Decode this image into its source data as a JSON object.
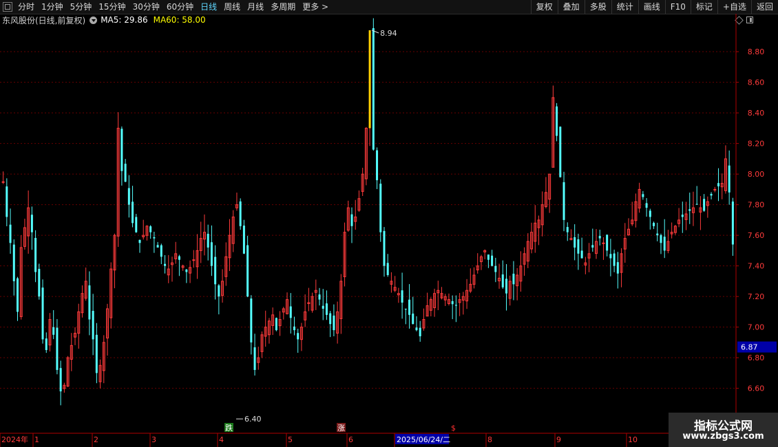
{
  "toolbar": {
    "left_items": [
      "分时",
      "1分钟",
      "5分钟",
      "15分钟",
      "30分钟",
      "60分钟",
      "日线",
      "周线",
      "月线",
      "多周期",
      "更多 >"
    ],
    "active_item": "日线",
    "right_items": [
      "复权",
      "叠加",
      "多股",
      "统计",
      "画线",
      "F10",
      "标记",
      "+自选",
      "返回"
    ]
  },
  "info": {
    "stock_name": "东风股份(日线,前复权)",
    "ma5": "MA5: 29.86",
    "ma60": "MA60: 58.00"
  },
  "chart_data": {
    "type": "candlestick",
    "ylim": [
      6.4,
      8.94
    ],
    "yticks": [
      "8.80",
      "8.60",
      "8.40",
      "8.20",
      "8.00",
      "7.80",
      "7.60",
      "7.40",
      "7.20",
      "7.00",
      "6.80",
      "6.60"
    ],
    "current_price": "6.87",
    "high_label": "8.94",
    "low_label": "6.40",
    "xlabels": [
      "2024年",
      "1",
      "2",
      "3",
      "4",
      "5",
      "6",
      "2025/06/24/二",
      "8",
      "9",
      "10"
    ],
    "markers": [
      "跌",
      "涨",
      "$"
    ],
    "colors": {
      "up": "#ff3b3b",
      "down": "#54ffff",
      "grid": "#6a0000",
      "axis": "#b00000",
      "highlight": "#ffd000"
    },
    "closes": [
      7.95,
      7.72,
      7.55,
      7.3,
      7.1,
      7.52,
      7.65,
      7.78,
      7.62,
      7.36,
      7.2,
      6.92,
      6.85,
      7.05,
      6.95,
      6.72,
      6.58,
      6.62,
      6.8,
      6.88,
      6.96,
      7.1,
      7.22,
      7.3,
      7.05,
      6.92,
      6.7,
      6.75,
      6.9,
      7.12,
      7.38,
      7.6,
      8.3,
      8.02,
      7.95,
      7.8,
      7.68,
      7.62,
      7.55,
      7.6,
      7.66,
      7.62,
      7.58,
      7.52,
      7.46,
      7.4,
      7.38,
      7.42,
      7.48,
      7.44,
      7.4,
      7.36,
      7.39,
      7.44,
      7.5,
      7.58,
      7.62,
      7.52,
      7.4,
      7.28,
      7.2,
      7.3,
      7.46,
      7.6,
      7.72,
      7.8,
      7.66,
      7.48,
      7.2,
      6.9,
      6.72,
      6.8,
      6.95,
      7.0,
      7.04,
      7.08,
      6.98,
      7.05,
      7.12,
      7.18,
      7.06,
      6.98,
      6.92,
      7.0,
      7.1,
      7.16,
      7.2,
      7.24,
      7.18,
      7.12,
      7.08,
      7.02,
      6.98,
      7.1,
      7.3,
      7.62,
      7.78,
      7.66,
      7.72,
      7.84,
      8.0,
      8.3,
      8.94,
      8.16,
      7.96,
      7.62,
      7.4,
      7.34,
      7.3,
      7.26,
      7.22,
      7.16,
      7.12,
      7.08,
      7.02,
      6.98,
      6.94,
      7.05,
      7.14,
      7.18,
      7.22,
      7.24,
      7.22,
      7.2,
      7.18,
      7.15,
      7.14,
      7.18,
      7.2,
      7.24,
      7.28,
      7.34,
      7.4,
      7.46,
      7.5,
      7.44,
      7.4,
      7.36,
      7.32,
      7.26,
      7.22,
      7.3,
      7.28,
      7.34,
      7.4,
      7.48,
      7.56,
      7.62,
      7.68,
      7.7,
      7.8,
      7.88,
      8.0,
      8.5,
      8.25,
      7.98,
      7.7,
      7.62,
      7.58,
      7.52,
      7.48,
      7.45,
      7.42,
      7.48,
      7.52,
      7.56,
      7.58,
      7.55,
      7.5,
      7.45,
      7.4,
      7.35,
      7.48,
      7.58,
      7.64,
      7.7,
      7.82,
      7.9,
      7.85,
      7.78,
      7.72,
      7.66,
      7.6,
      7.55,
      7.5,
      7.56,
      7.62,
      7.66,
      7.7,
      7.72,
      7.74,
      7.76,
      7.78,
      7.8,
      7.78,
      7.76,
      7.82,
      7.86,
      7.9,
      7.92,
      7.94,
      8.1,
      7.88,
      7.54
    ]
  }
}
